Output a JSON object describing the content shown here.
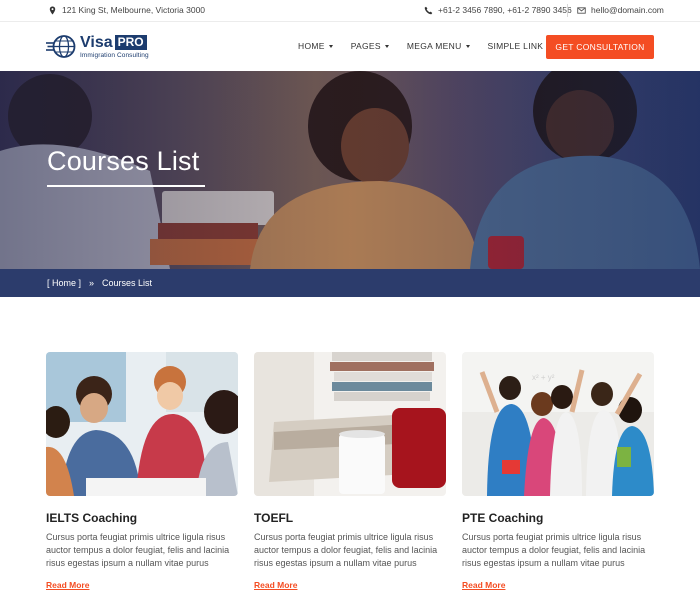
{
  "topbar": {
    "address": "121 King St, Melbourne, Victoria 3000",
    "phones": "+61-2 3456 7890,  +61-2 7890 3456",
    "email": "hello@domain.com"
  },
  "header": {
    "logo": {
      "word": "Visa",
      "badge": "PRO",
      "subtitle": "Immigration Consulting"
    },
    "nav": [
      {
        "label": "HOME",
        "has_dropdown": true
      },
      {
        "label": "PAGES",
        "has_dropdown": true
      },
      {
        "label": "MEGA MENU",
        "has_dropdown": true
      },
      {
        "label": "SIMPLE LINK",
        "has_dropdown": false
      }
    ],
    "cta_label": "GET CONSULTATION"
  },
  "hero": {
    "title": "Courses List",
    "breadcrumb": {
      "home": "[ Home ]",
      "separator": "»",
      "current": "Courses List"
    }
  },
  "courses": [
    {
      "title": "IELTS Coaching",
      "description": "Cursus porta feugiat primis ultrice ligula risus auctor tempus a dolor feugiat, felis and lacinia risus egestas ipsum a nullam vitae purus",
      "link": "Read More"
    },
    {
      "title": "TOEFL",
      "description": "Cursus porta feugiat primis ultrice ligula risus auctor tempus a dolor feugiat, felis and lacinia risus egestas ipsum a nullam vitae purus",
      "link": "Read More"
    },
    {
      "title": "PTE Coaching",
      "description": "Cursus porta feugiat primis ultrice ligula risus auctor tempus a dolor feugiat, felis and lacinia risus egestas ipsum a nullam vitae purus",
      "link": "Read More"
    }
  ],
  "colors": {
    "accent": "#f44d23",
    "brand": "#1c3c6e",
    "breadcrumb_bg": "#2c3c6c"
  },
  "icons": {
    "address": "map-pin-icon",
    "phone": "phone-icon",
    "email": "envelope-icon"
  }
}
